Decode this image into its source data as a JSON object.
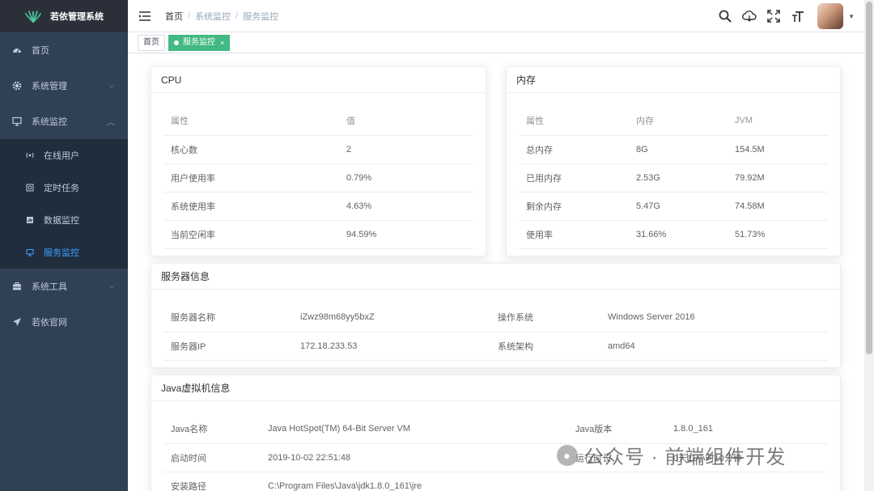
{
  "app": {
    "title": "若依管理系统"
  },
  "sidebar": {
    "items": [
      {
        "label": "首页",
        "icon": "dashboard-icon"
      },
      {
        "label": "系统管理",
        "icon": "gear-icon"
      },
      {
        "label": "系统监控",
        "icon": "monitor-icon",
        "expanded": true,
        "children": [
          {
            "label": "在线用户",
            "icon": "online-icon"
          },
          {
            "label": "定时任务",
            "icon": "job-icon"
          },
          {
            "label": "数据监控",
            "icon": "druid-icon"
          },
          {
            "label": "服务监控",
            "icon": "server-icon",
            "active": true
          }
        ]
      },
      {
        "label": "系统工具",
        "icon": "toolbox-icon"
      },
      {
        "label": "若依官网",
        "icon": "send-icon"
      }
    ]
  },
  "breadcrumb": [
    "首页",
    "系统监控",
    "服务监控"
  ],
  "tags": [
    {
      "label": "首页",
      "active": false
    },
    {
      "label": "服务监控",
      "active": true,
      "close": "×"
    }
  ],
  "cpu": {
    "title": "CPU",
    "headers": [
      "属性",
      "值"
    ],
    "rows": [
      [
        "核心数",
        "2"
      ],
      [
        "用户使用率",
        "0.79%"
      ],
      [
        "系统使用率",
        "4.63%"
      ],
      [
        "当前空闲率",
        "94.59%"
      ]
    ]
  },
  "memory": {
    "title": "内存",
    "headers": [
      "属性",
      "内存",
      "JVM"
    ],
    "rows": [
      [
        "总内存",
        "8G",
        "154.5M"
      ],
      [
        "已用内存",
        "2.53G",
        "79.92M"
      ],
      [
        "剩余内存",
        "5.47G",
        "74.58M"
      ],
      [
        "使用率",
        "31.66%",
        "51.73%"
      ]
    ]
  },
  "server": {
    "title": "服务器信息",
    "rows": [
      [
        "服务器名称",
        "iZwz98m68yy5bxZ",
        "操作系统",
        "Windows Server 2016"
      ],
      [
        "服务器IP",
        "172.18.233.53",
        "系统架构",
        "amd64"
      ]
    ]
  },
  "jvm": {
    "title": "Java虚拟机信息",
    "rows": [
      [
        "Java名称",
        "Java HotSpot(TM) 64-Bit Server VM",
        "Java版本",
        "1.8.0_161"
      ],
      [
        "启动时间",
        "2019-10-02 22:51:48",
        "运行时长",
        "0天11小时10分钟"
      ],
      [
        "安装路径",
        "C:\\Program Files\\Java\\jdk1.8.0_161\\jre",
        "",
        ""
      ]
    ]
  },
  "watermark": {
    "text": "公众号 · 前端组件开发"
  },
  "colors": {
    "sidebar_bg": "#304156",
    "logo_bg": "#2b2f3a",
    "active_blue": "#409eff",
    "tag_green": "#42b983"
  }
}
